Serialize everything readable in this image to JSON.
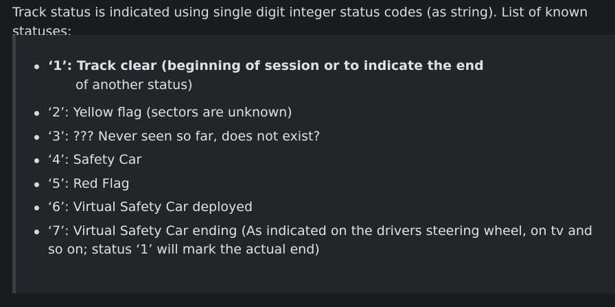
{
  "intro_text": "Track status is indicated using single digit integer status codes (as string). List of known statuses:",
  "statuses": [
    {
      "code": "'1'",
      "text_main": "‘1’: Track clear (beginning of session or to indicate the end",
      "text_cont": "of another status)"
    },
    {
      "code": "'2'",
      "text": "‘2’: Yellow flag (sectors are unknown)"
    },
    {
      "code": "'3'",
      "text": "‘3’: ??? Never seen so far, does not exist?"
    },
    {
      "code": "'4'",
      "text": "‘4’: Safety Car"
    },
    {
      "code": "'5'",
      "text": "‘5’: Red Flag"
    },
    {
      "code": "'6'",
      "text": "‘6’: Virtual Safety Car deployed"
    },
    {
      "code": "'7'",
      "text": "‘7’: Virtual Safety Car ending (As indicated on the drivers steering wheel, on tv and so on; status ‘1’ will mark the actual end)"
    }
  ]
}
